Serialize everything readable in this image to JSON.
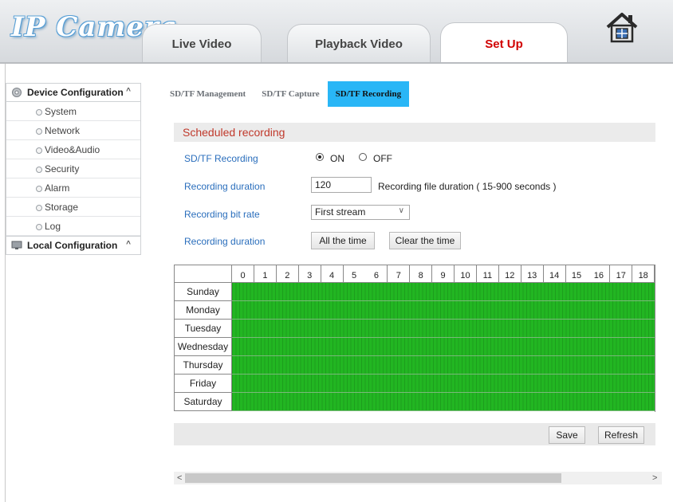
{
  "header": {
    "logo": "IP Camera",
    "tabs": [
      {
        "label": "Live Video",
        "active": false
      },
      {
        "label": "Playback Video",
        "active": false
      },
      {
        "label": "Set Up",
        "active": true
      }
    ],
    "home_icon": "home-icon",
    "active_color": "#d10000"
  },
  "sidebar": {
    "device_config": {
      "label": "Device Configuration",
      "icon": "gear-icon",
      "items": [
        "System",
        "Network",
        "Video&Audio",
        "Security",
        "Alarm",
        "Storage",
        "Log"
      ]
    },
    "local_config": {
      "label": "Local Configuration",
      "icon": "monitor-icon"
    }
  },
  "subtabs": [
    {
      "label": "SD/TF Management",
      "active": false
    },
    {
      "label": "SD/TF Capture",
      "active": false
    },
    {
      "label": "SD/TF Recording",
      "active": true
    }
  ],
  "form": {
    "section_title": "Scheduled recording",
    "recording_label": "SD/TF Recording",
    "on_label": "ON",
    "off_label": "OFF",
    "recording_on": true,
    "duration_label": "Recording duration",
    "duration_value": "120",
    "duration_help": "Recording file duration ( 15-900 seconds )",
    "bitrate_label": "Recording bit rate",
    "bitrate_value": "First stream",
    "schedule_label": "Recording duration",
    "all_time_btn": "All the time",
    "clear_time_btn": "Clear the time"
  },
  "schedule": {
    "hours": [
      "0",
      "1",
      "2",
      "3",
      "4",
      "5",
      "6",
      "7",
      "8",
      "9",
      "10",
      "11",
      "12",
      "13",
      "14",
      "15",
      "16",
      "17",
      "18"
    ],
    "days": [
      "Sunday",
      "Monday",
      "Tuesday",
      "Wednesday",
      "Thursday",
      "Friday",
      "Saturday"
    ],
    "fill_color": "#22b622",
    "all_selected": true
  },
  "footer": {
    "save": "Save",
    "refresh": "Refresh"
  },
  "scrollbar": {
    "left_arrow": "<",
    "right_arrow": ">"
  }
}
